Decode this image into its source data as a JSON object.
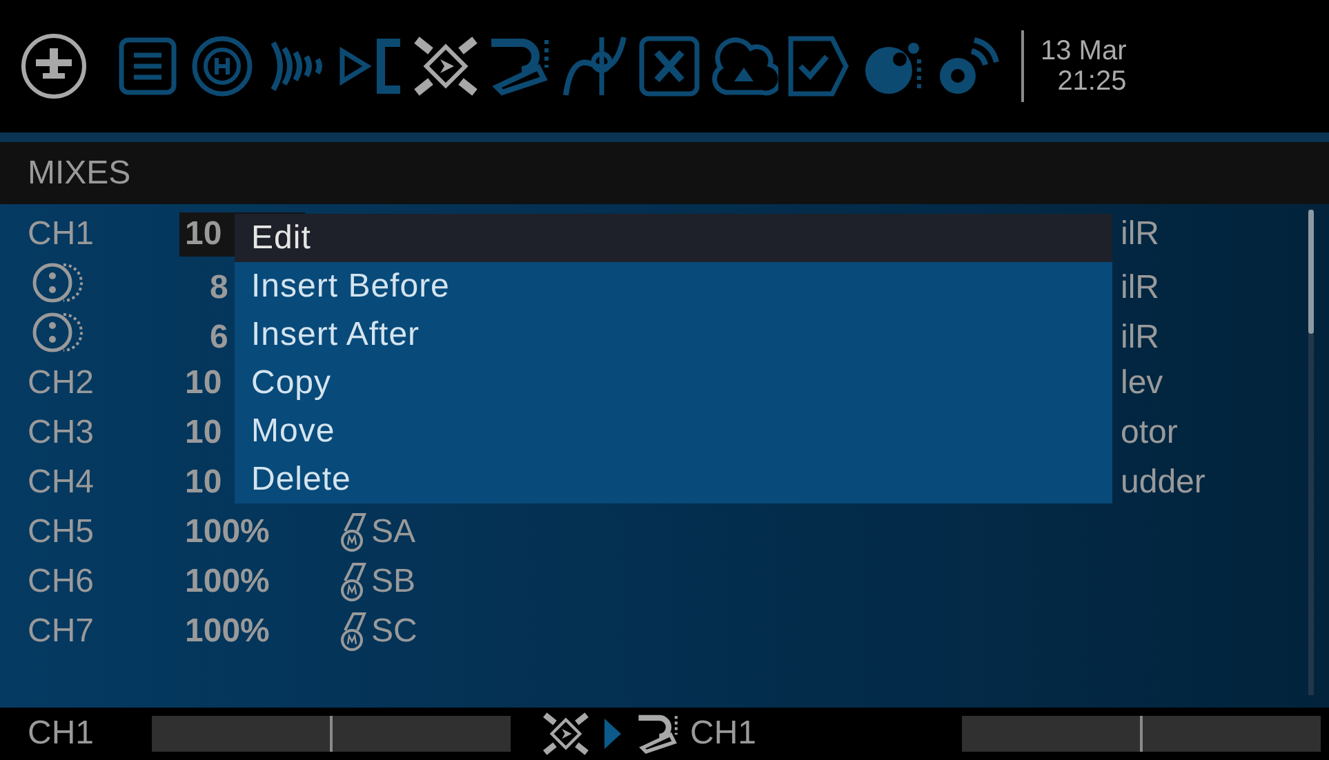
{
  "top_bar": {
    "tabs": [
      {
        "kind": "notes",
        "selected": false
      },
      {
        "kind": "heli",
        "selected": false
      },
      {
        "kind": "outputs",
        "selected": false
      },
      {
        "kind": "inputs",
        "selected": false
      },
      {
        "kind": "mixes",
        "selected": true
      },
      {
        "kind": "outputs2",
        "selected": false
      },
      {
        "kind": "curves",
        "selected": false
      },
      {
        "kind": "variable",
        "selected": false
      },
      {
        "kind": "cloud",
        "selected": false
      },
      {
        "kind": "checklist",
        "selected": false
      },
      {
        "kind": "dial",
        "selected": false
      },
      {
        "kind": "telemetry",
        "selected": false
      }
    ],
    "date": "13 Mar",
    "time": "21:25"
  },
  "header": {
    "title": "MIXES"
  },
  "mixes": [
    {
      "kind": "channel",
      "label": "CH1",
      "weight": "10",
      "name": "ilR",
      "selected": true
    },
    {
      "kind": "line",
      "weight": "8",
      "name": "ilR",
      "selected": false
    },
    {
      "kind": "line",
      "weight": "6",
      "name": "ilR",
      "selected": false
    },
    {
      "kind": "channel",
      "label": "CH2",
      "weight": "10",
      "name": "lev",
      "selected": false
    },
    {
      "kind": "channel",
      "label": "CH3",
      "weight": "10",
      "name": "otor",
      "selected": false
    },
    {
      "kind": "channel",
      "label": "CH4",
      "weight": "10",
      "name": "udder",
      "selected": false
    },
    {
      "kind": "channel",
      "label": "CH5",
      "weight": "100%",
      "source": "SA",
      "selected": false
    },
    {
      "kind": "channel",
      "label": "CH6",
      "weight": "100%",
      "source": "SB",
      "selected": false
    },
    {
      "kind": "channel",
      "label": "CH7",
      "weight": "100%",
      "source": "SC",
      "selected": false
    }
  ],
  "context_menu": [
    {
      "label": "Edit",
      "selected": true
    },
    {
      "label": "Insert Before",
      "selected": false
    },
    {
      "label": "Insert After",
      "selected": false
    },
    {
      "label": "Copy",
      "selected": false
    },
    {
      "label": "Move",
      "selected": false
    },
    {
      "label": "Delete",
      "selected": false
    }
  ],
  "footer": {
    "input_label": "CH1",
    "output_label": "CH1"
  }
}
